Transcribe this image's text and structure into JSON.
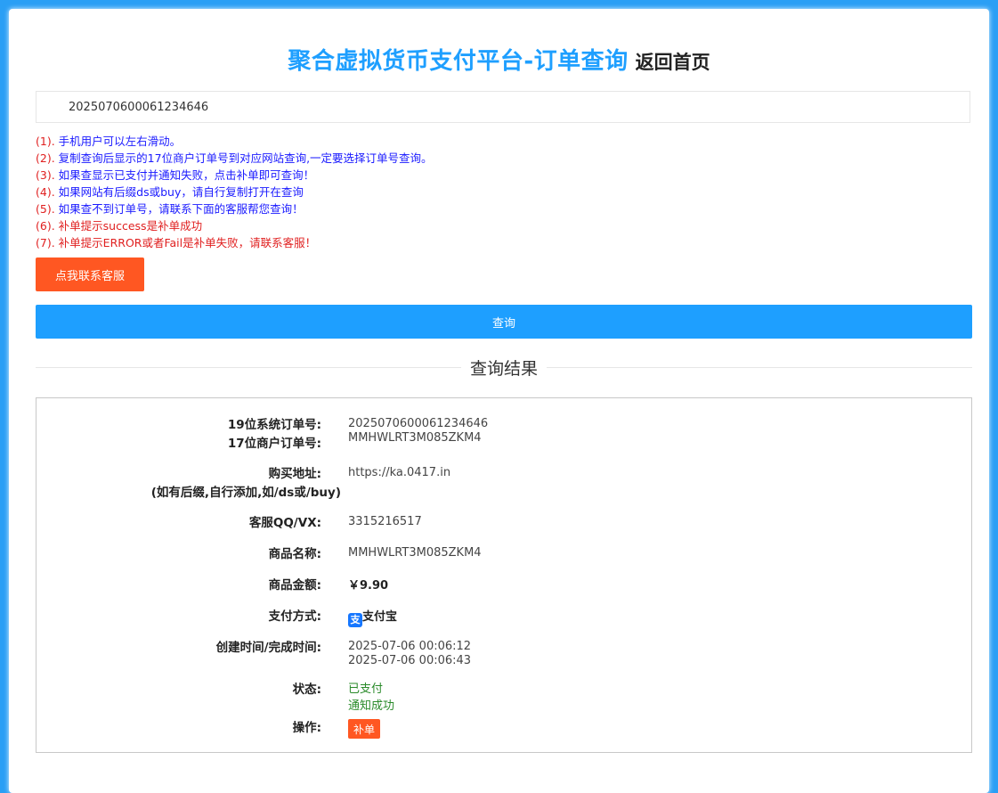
{
  "header": {
    "title": "聚合虚拟货币支付平台-订单查询",
    "home_link": "返回首页"
  },
  "search": {
    "value": "2025070600061234646"
  },
  "notes": [
    {
      "num": "(1).",
      "text": "手机用户可以左右滑动。"
    },
    {
      "num": "(2).",
      "text": "复制查询后显示的17位商户订单号到对应网站查询,一定要选择订单号查询。"
    },
    {
      "num": "(3).",
      "text": "如果查显示已支付并通知失败，点击补单即可查询！"
    },
    {
      "num": "(4).",
      "text": "如果网站有后缀ds或buy，请自行复制打开在查询"
    },
    {
      "num": "(5).",
      "text": "如果查不到订单号，请联系下面的客服帮您查询！"
    },
    {
      "num": "(6).",
      "text": "补单提示success是补单成功"
    },
    {
      "num": "(7).",
      "text": "补单提示ERROR或者Fail是补单失败，请联系客服！"
    }
  ],
  "buttons": {
    "contact": "点我联系客服",
    "query": "查询"
  },
  "divider": {
    "legend": "查询结果"
  },
  "result": {
    "sys_order_label": "19位系统订单号:",
    "sys_order": "2025070600061234646",
    "merchant_order_label": "17位商户订单号:",
    "merchant_order": "MMHWLRT3M085ZKM4",
    "buy_url_label": "购买地址:",
    "buy_url_note": "(如有后缀,自行添加,如/ds或/buy)",
    "buy_url": "https://ka.0417.in",
    "service_label": "客服QQ/VX:",
    "service": "3315216517",
    "product_label": "商品名称:",
    "product": "MMHWLRT3M085ZKM4",
    "amount_label": "商品金额:",
    "amount": "￥9.90",
    "pay_label": "支付方式:",
    "pay_icon": "支",
    "pay_method": "支付宝",
    "time_label": "创建时间/完成时间:",
    "created": "2025-07-06 00:06:12",
    "completed": "2025-07-06 00:06:43",
    "status_label": "状态:",
    "status_paid": "已支付",
    "status_notify": "通知成功",
    "action_label": "操作:",
    "action_button": "补单"
  },
  "colors": {
    "background": "#2a9ff5",
    "title": "#1e9fff",
    "primary_button": "#1e9fff",
    "warn_button": "#ff5722",
    "status_green": "#2a8a2a",
    "note_red": "#e02020",
    "note_blue": "#1a1aff",
    "alipay": "#1677ff"
  }
}
